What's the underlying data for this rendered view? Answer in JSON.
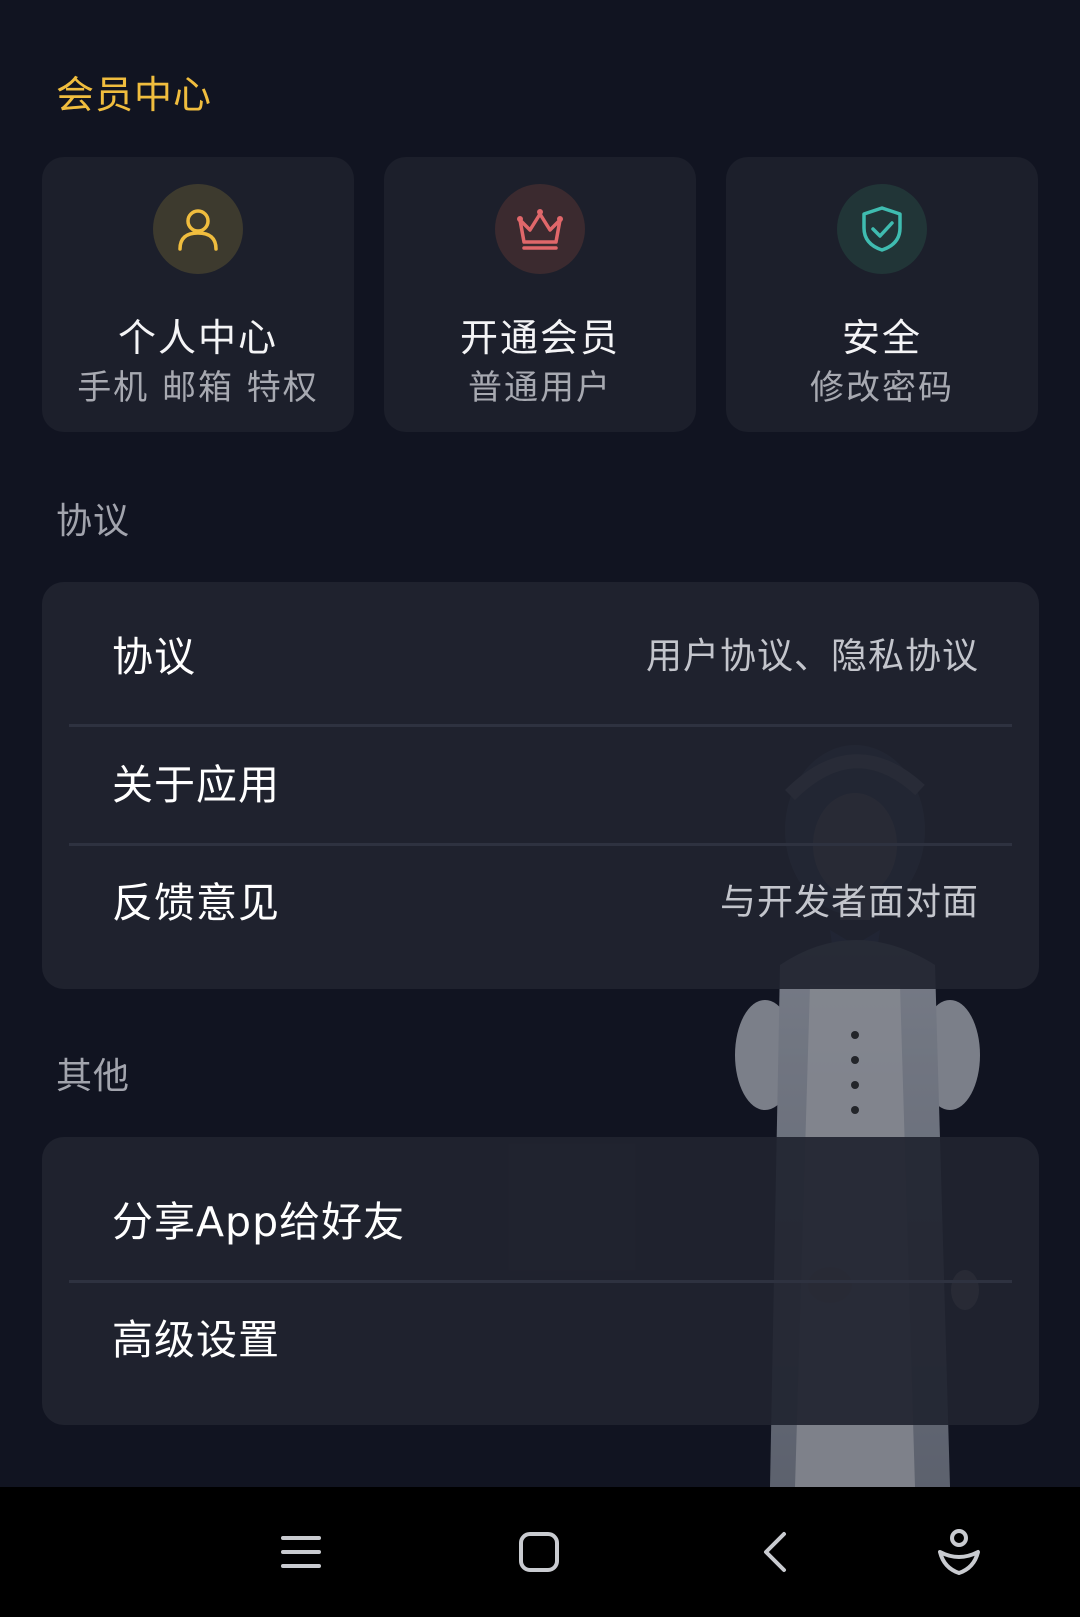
{
  "member_center": {
    "title": "会员中心",
    "cards": [
      {
        "icon": "user-icon",
        "title": "个人中心",
        "subtitle": "手机 邮箱 特权",
        "icon_color": "#f0bd3e",
        "circle_color": "#3d3a2e"
      },
      {
        "icon": "crown-icon",
        "title": "开通会员",
        "subtitle": "普通用户",
        "icon_color": "#e0676a",
        "circle_color": "#3b2a2f"
      },
      {
        "icon": "shield-check-icon",
        "title": "安全",
        "subtitle": "修改密码",
        "icon_color": "#3fbcb0",
        "circle_color": "#213537"
      }
    ]
  },
  "agreement": {
    "section_label": "协议",
    "rows": [
      {
        "label": "协议",
        "value": "用户协议、隐私协议"
      },
      {
        "label": "关于应用",
        "value": ""
      },
      {
        "label": "反馈意见",
        "value": "与开发者面对面"
      }
    ]
  },
  "other": {
    "section_label": "其他",
    "rows": [
      {
        "label": "分享App给好友"
      },
      {
        "label": "高级设置"
      }
    ]
  },
  "navbar": {
    "buttons": [
      "menu-icon",
      "home-square-icon",
      "back-icon",
      "assistant-icon"
    ]
  },
  "colors": {
    "background": "#111421",
    "card": "#1c1f2b",
    "accent_gold": "#f0bd3e"
  }
}
